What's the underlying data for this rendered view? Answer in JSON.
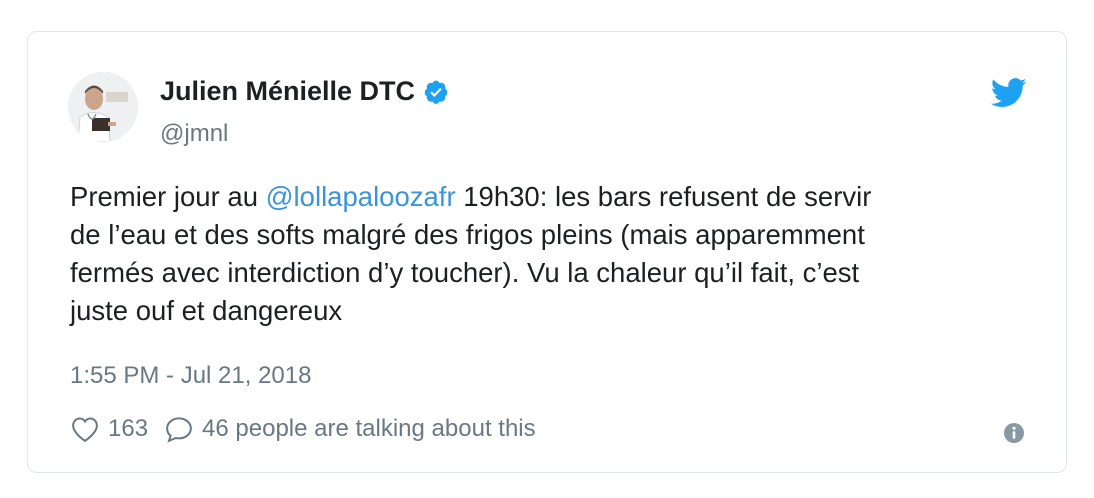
{
  "author": {
    "name": "Julien Ménielle DTC",
    "handle": "@jmnl",
    "verified": true
  },
  "tweet": {
    "text_before": "Premier jour au ",
    "mention": "@lollapaloozafr",
    "text_after": " 19h30: les bars refusent de servir\nde l’eau et des softs malgré des frigos pleins (mais apparemment\nfermés avec interdiction d’y toucher). Vu la chaleur qu’il fait, c’est\njuste ouf et dangereux",
    "timestamp": "1:55 PM - Jul 21, 2018"
  },
  "actions": {
    "likes": "163",
    "replies_label": "46 people are talking about this"
  },
  "icons": {
    "brand": "twitter-bird-icon",
    "verified": "verified-badge-icon",
    "like": "heart-icon",
    "reply": "speech-bubble-icon",
    "info": "info-icon"
  },
  "colors": {
    "accent": "#1da1f2",
    "link": "#3b94d9",
    "muted": "#697882",
    "text": "#1c2022",
    "border": "#e1e8ed"
  }
}
